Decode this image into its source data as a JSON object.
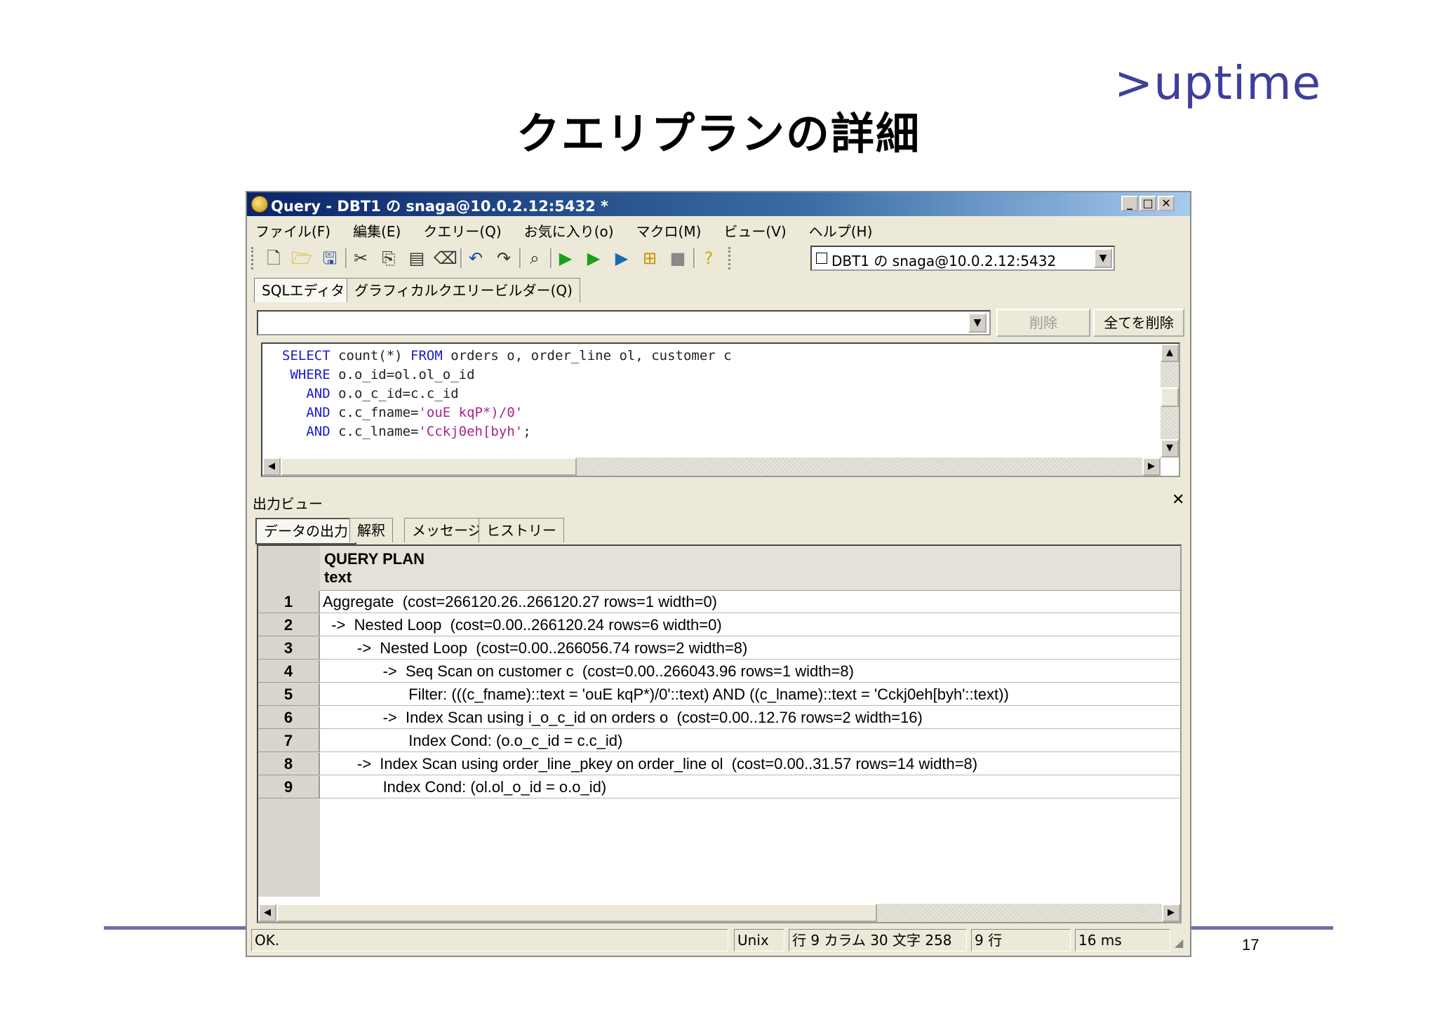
{
  "slide": {
    "title": "クエリプランの詳細",
    "logo": ">uptime",
    "page_number": "17"
  },
  "window": {
    "title": "Query - DBT1 の snaga@10.0.2.12:5432 *",
    "menu": [
      "ファイル(F)",
      "編集(E)",
      "クエリー(Q)",
      "お気に入り(o)",
      "マクロ(M)",
      "ビュー(V)",
      "ヘルプ(H)"
    ],
    "connection": "DBT1 の snaga@10.0.2.12:5432",
    "editor_tabs": [
      "SQLエディタ",
      "グラフィカルクエリービルダー(Q)"
    ],
    "delete_button": "削除",
    "delete_all_button": "全てを削除",
    "sql": {
      "line1_kw1": "SELECT",
      "line1_mid": " count(*) ",
      "line1_kw2": "FROM",
      "line1_rest": " orders o, order_line ol, customer c",
      "line2_kw": " WHERE",
      "line2_rest": " o.o_id=ol.ol_o_id",
      "line3_kw": "   AND",
      "line3_rest": " o.o_c_id=c.c_id",
      "line4_kw": "   AND",
      "line4_rest": " c.c_fname=",
      "line4_str": "'ouE kqP*)/0'",
      "line5_kw": "   AND",
      "line5_rest": " c.c_lname=",
      "line5_str": "'Cckj0eh[byh'",
      "line5_end": ";"
    },
    "output": {
      "title": "出力ビュー",
      "tabs": [
        "データの出力",
        "解釈",
        "メッセージ",
        "ヒストリー"
      ],
      "column_name": "QUERY PLAN",
      "column_type": "text",
      "rows": [
        {
          "n": "1",
          "text": "Aggregate  (cost=266120.26..266120.27 rows=1 width=0)"
        },
        {
          "n": "2",
          "text": "  ->  Nested Loop  (cost=0.00..266120.24 rows=6 width=0)"
        },
        {
          "n": "3",
          "text": "        ->  Nested Loop  (cost=0.00..266056.74 rows=2 width=8)"
        },
        {
          "n": "4",
          "text": "              ->  Seq Scan on customer c  (cost=0.00..266043.96 rows=1 width=8)"
        },
        {
          "n": "5",
          "text": "                    Filter: (((c_fname)::text = 'ouE kqP*)/0'::text) AND ((c_lname)::text = 'Cckj0eh[byh'::text))"
        },
        {
          "n": "6",
          "text": "              ->  Index Scan using i_o_c_id on orders o  (cost=0.00..12.76 rows=2 width=16)"
        },
        {
          "n": "7",
          "text": "                    Index Cond: (o.o_c_id = c.c_id)"
        },
        {
          "n": "8",
          "text": "        ->  Index Scan using order_line_pkey on order_line ol  (cost=0.00..31.57 rows=14 width=8)"
        },
        {
          "n": "9",
          "text": "              Index Cond: (ol.ol_o_id = o.o_id)"
        }
      ]
    },
    "status": {
      "message": "OK.",
      "line_ending": "Unix",
      "cursor": "行 9 カラム 30  文字 258",
      "row_count": "9 行",
      "elapsed": "16 ms"
    }
  }
}
